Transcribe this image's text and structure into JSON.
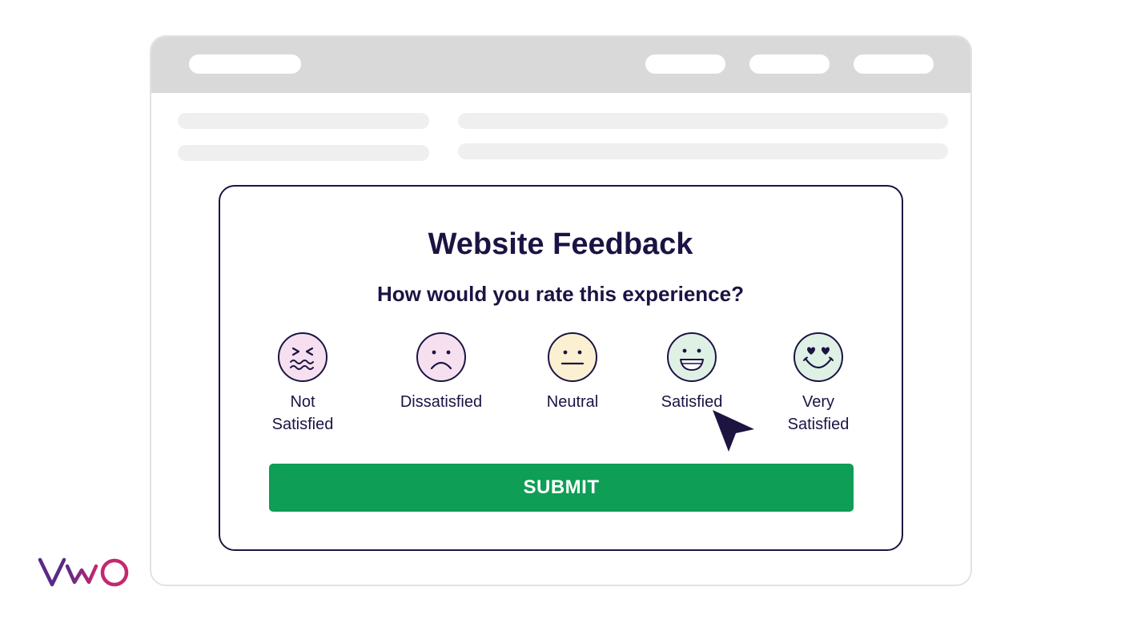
{
  "feedback": {
    "title": "Website Feedback",
    "question": "How would you rate this experience?",
    "options": [
      {
        "label": "Not\nSatisfied",
        "icon": "confounded-face-icon",
        "color": "#f6e0ef"
      },
      {
        "label": "Dissatisfied",
        "icon": "frowning-face-icon",
        "color": "#f6e0ef"
      },
      {
        "label": "Neutral",
        "icon": "neutral-face-icon",
        "color": "#fbf1d2"
      },
      {
        "label": "Satisfied",
        "icon": "grinning-face-icon",
        "color": "#dff0e4"
      },
      {
        "label": "Very\nSatisfied",
        "icon": "heart-eyes-face-icon",
        "color": "#dff0e4"
      }
    ],
    "submit_label": "SUBMIT"
  },
  "theme": {
    "ink": "#1a1443",
    "submit_color": "#0e9e55",
    "logo_gradient": [
      "#5b2a86",
      "#c4286f"
    ]
  },
  "logo": {
    "text": "VWO"
  }
}
